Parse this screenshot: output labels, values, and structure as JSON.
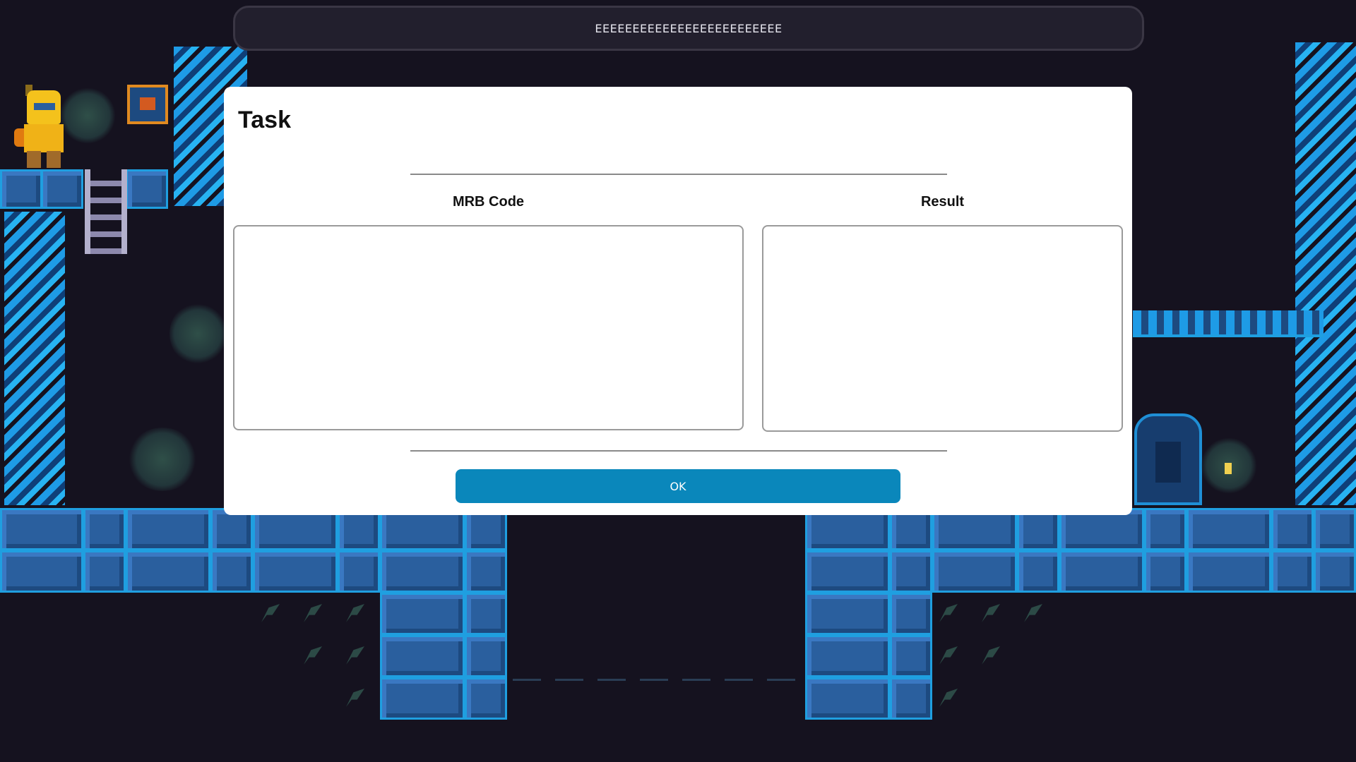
{
  "topbar": {
    "text": "EEEEEEEEEEEEEEEEEEEEEEEEE"
  },
  "dialog": {
    "title": "Task",
    "code_label": "MRB Code",
    "result_label": "Result",
    "code_value": "",
    "result_value": "",
    "ok_label": "OK"
  },
  "colors": {
    "ok_button": "#0a87bb",
    "brick": "#2a5f9e",
    "brick_edge": "#1f9fe0",
    "background": "#15121f"
  }
}
